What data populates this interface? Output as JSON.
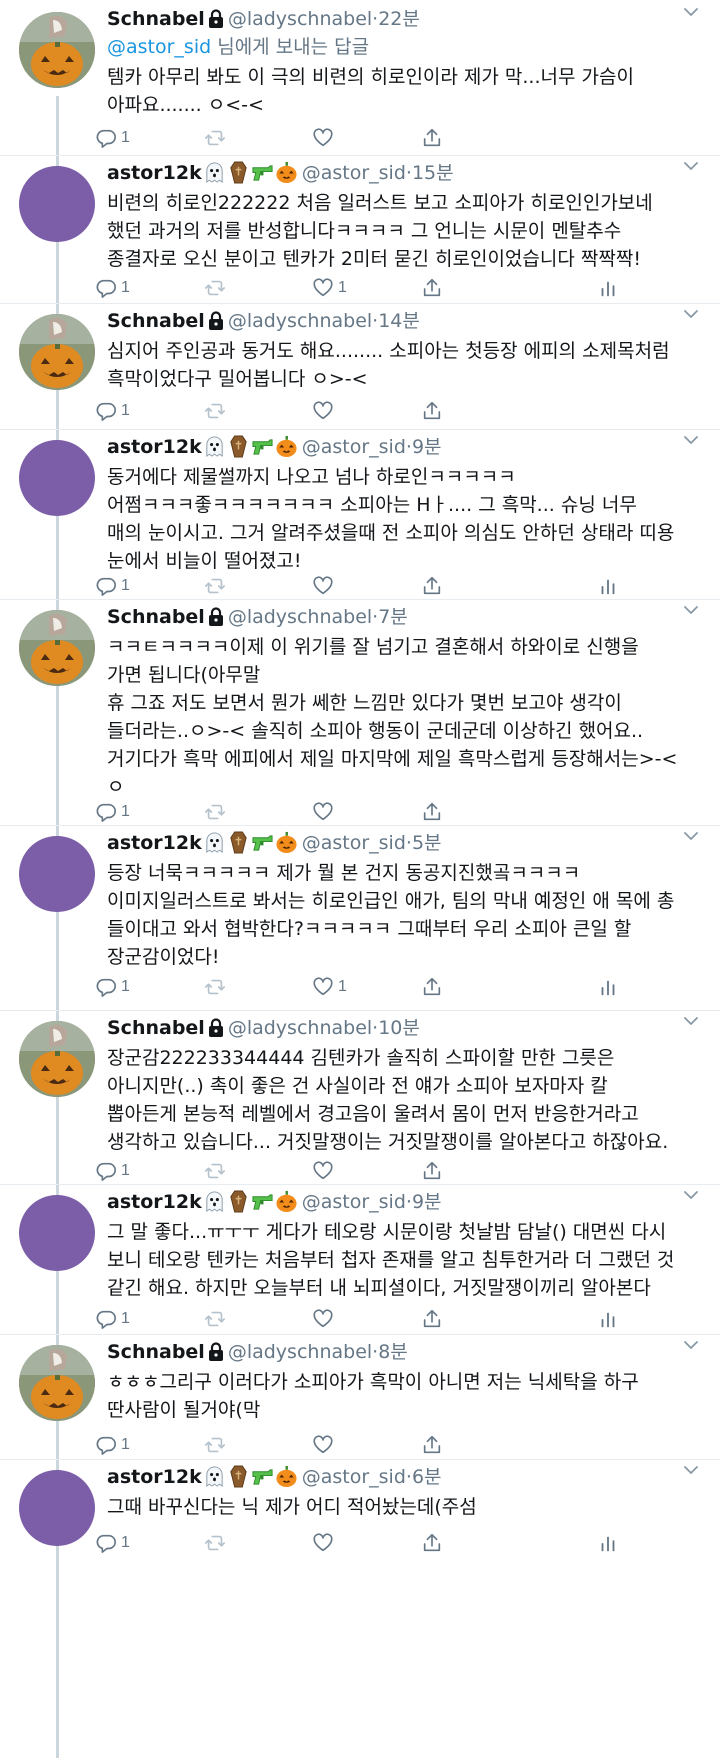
{
  "icons": {
    "lock": "lock-icon",
    "caret": "chevron-down-icon",
    "reply": "reply-icon",
    "retweet": "retweet-icon",
    "like": "heart-icon",
    "share": "share-icon",
    "analytics": "analytics-icon",
    "ghost": "ghost-emoji",
    "coffin": "coffin-emoji",
    "water_pistol": "water-pistol-emoji",
    "jack_o_lantern": "jack-o-lantern-emoji"
  },
  "colors": {
    "link": "#1b95e0",
    "muted": "#657786",
    "thread_line": "#ccd6dd",
    "avatar_purple": "#7b5ea7"
  },
  "tweets": [
    {
      "name": "Schnabel",
      "handle": "@ladyschnabel",
      "dot": "·",
      "time": "22분",
      "replying_mention": "@astor_sid",
      "replying_rest": " 님에게 보내는 답글",
      "text": "템카 아무리 봐도 이 극의 비련의 히로인이라 제가 막...너무 가슴이\n아파요....... ㅇ<-<",
      "reply_count": "1",
      "retweet_count": "",
      "like_count": ""
    },
    {
      "name": "astor12k",
      "handle": "@astor_sid",
      "dot": "·",
      "time": "15분",
      "text": "비련의 히로인222222 처음 일러스트 보고 소피아가 히로인인가보네\n했던 과거의 저를 반성합니다ㅋㅋㅋㅋ 그 언니는 시문이 멘탈추수\n종결자로 오신 분이고 텐카가 2미터 묻긴 히로인이었습니다 짝짝짝!",
      "reply_count": "1",
      "retweet_count": "",
      "like_count": "1"
    },
    {
      "name": "Schnabel",
      "handle": "@ladyschnabel",
      "dot": "·",
      "time": "14분",
      "text": "심지어 주인공과 동거도 해요........ 소피아는 첫등장 에피의 소제목처럼\n흑막이었다구 밀어봅니다 ㅇ>-<",
      "reply_count": "1",
      "retweet_count": "",
      "like_count": ""
    },
    {
      "name": "astor12k",
      "handle": "@astor_sid",
      "dot": "·",
      "time": "9분",
      "text": "동거에다 제물썰까지 나오고 넘나 하로인ㅋㅋㅋㅋㅋ\n어쩜ㅋㅋㅋ좋ㅋㅋㅋㅋㅋㅋㅋ 소피아는 Hㅏ.... 그 흑막... 슈닝 너무\n매의 눈이시고. 그거 알려주셨을때 전 소피아 의심도 안하던 상태라 띠용\n눈에서 비늘이 떨어졌고!",
      "reply_count": "1",
      "retweet_count": "",
      "like_count": ""
    },
    {
      "name": "Schnabel",
      "handle": "@ladyschnabel",
      "dot": "·",
      "time": "7분",
      "text": "ㅋㅋㅌㅋㅋㅋㅋ이제 이 위기를 잘 넘기고 결혼해서 하와이로 신행을\n가면 됩니다(아무말\n휴 그죠 저도 보면서 뭔가 쎄한 느낌만 있다가 몇번 보고야 생각이\n들더라는..ㅇ>-< 솔직히 소피아 행동이 군데군데 이상하긴 했어요..\n거기다가 흑막 에피에서 제일 마지막에 제일 흑막스럽게 등장해서는>-<\nㅇ",
      "reply_count": "1",
      "retweet_count": "",
      "like_count": ""
    },
    {
      "name": "astor12k",
      "handle": "@astor_sid",
      "dot": "·",
      "time": "5분",
      "text": "등장 너묵ㅋㅋㅋㅋㅋ 제가 뭘 본 건지 동공지진했곸ㅋㅋㅋㅋ\n이미지일러스트로 봐서는 히로인급인 애가, 팀의 막내 예정인 애 목에 총\n들이대고 와서 협박한다?ㅋㅋㅋㅋㅋ 그때부터 우리 소피아 큰일 할\n장군감이었다!",
      "reply_count": "1",
      "retweet_count": "",
      "like_count": "1"
    },
    {
      "name": "Schnabel",
      "handle": "@ladyschnabel",
      "dot": "·",
      "time": "10분",
      "text": "장군감222233344444 김텐카가 솔직히 스파이할 만한 그릇은\n아니지만(..) 촉이 좋은 건 사실이라 전 얘가 소피아 보자마자 칼\n뽑아든게 본능적 레벨에서 경고음이 울려서 몸이 먼저 반응한거라고\n생각하고 있습니다... 거짓말쟁이는 거짓말쟁이를 알아본다고 하잖아요.",
      "reply_count": "1",
      "retweet_count": "",
      "like_count": ""
    },
    {
      "name": "astor12k",
      "handle": "@astor_sid",
      "dot": "·",
      "time": "9분",
      "text": "그 말 좋다...ㅠㅜㅜ 게다가 테오랑 시문이랑 첫날밤 담날() 대면씬 다시\n보니 테오랑 텐카는 처음부터 첩자 존재를 알고 침투한거라 더 그랬던 것\n같긴 해요. 하지만 오늘부터 내 뇌피셜이다, 거짓말쟁이끼리 알아본다",
      "reply_count": "1",
      "retweet_count": "",
      "like_count": ""
    },
    {
      "name": "Schnabel",
      "handle": "@ladyschnabel",
      "dot": "·",
      "time": "8분",
      "text": "ㅎㅎㅎ그리구 이러다가 소피아가 흑막이 아니면 저는 닉세탁을 하구\n딴사람이 될거야(막",
      "reply_count": "1",
      "retweet_count": "",
      "like_count": ""
    },
    {
      "name": "astor12k",
      "handle": "@astor_sid",
      "dot": "·",
      "time": "6분",
      "text": "그때 바꾸신다는 닉 제가 어디 적어놨는데(주섬",
      "reply_count": "1",
      "retweet_count": "",
      "like_count": ""
    }
  ]
}
